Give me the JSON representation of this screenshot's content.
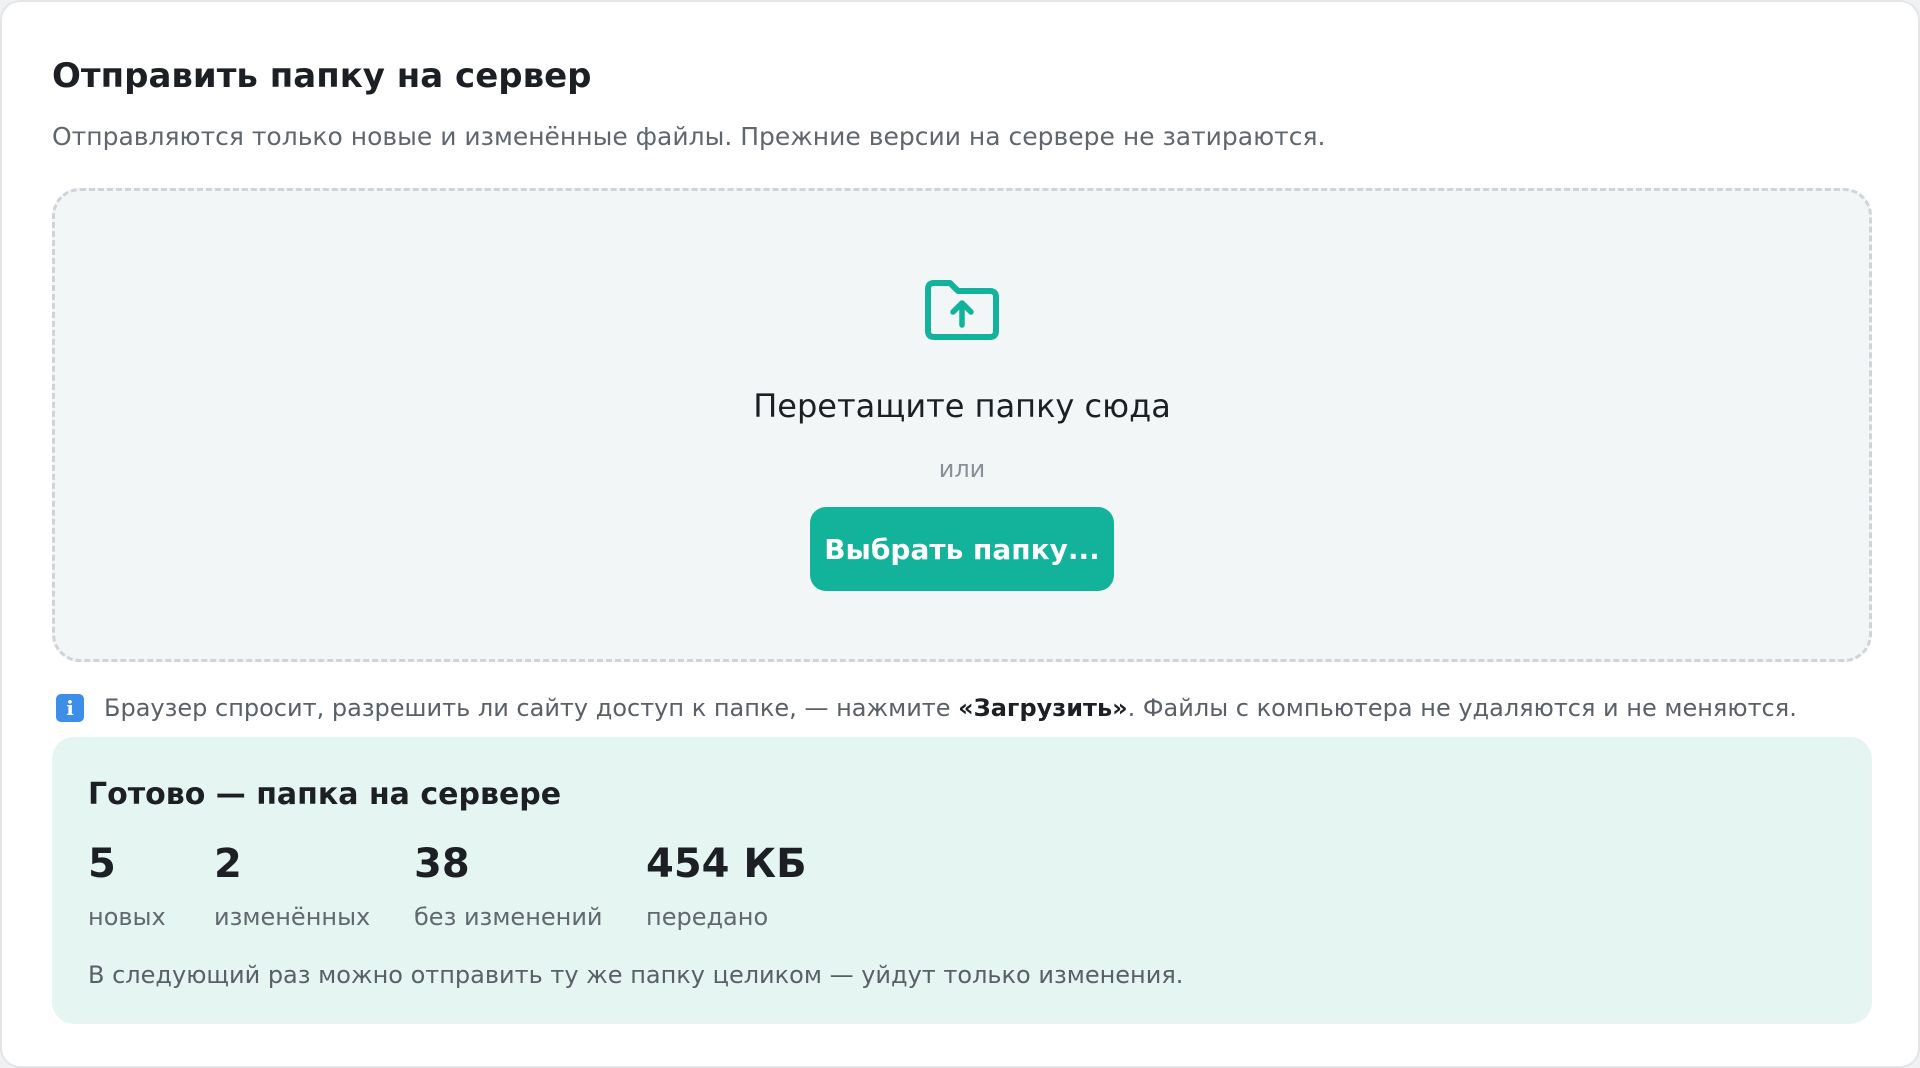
{
  "header": {
    "title": "Отправить папку на сервер",
    "subtitle": "Отправляются только новые и изменённые файлы. Прежние версии на сервере не затираются."
  },
  "dropzone": {
    "icon": "folder-upload-icon",
    "title": "Перетащите папку сюда",
    "or": "или",
    "button_label": "Выбрать папку..."
  },
  "info": {
    "icon": "info-icon",
    "text_before": "Браузер спросит, разрешить ли сайту доступ к папке, — нажмите ",
    "text_bold": "«Загрузить»",
    "text_after": ". Файлы с компьютера не удаляются и не меняются."
  },
  "result": {
    "title": "Готово — папка на сервере",
    "stats": [
      {
        "value": "5",
        "label": "новых"
      },
      {
        "value": "2",
        "label": "изменённых"
      },
      {
        "value": "38",
        "label": "без изменений"
      },
      {
        "value": "454 КБ",
        "label": "передано"
      }
    ],
    "note": "В следующий раз можно отправить ту же папку целиком — уйдут только изменения."
  },
  "colors": {
    "accent": "#12b39a",
    "result_bg": "#e5f5f1",
    "dropzone_bg": "#f2f6f7"
  }
}
